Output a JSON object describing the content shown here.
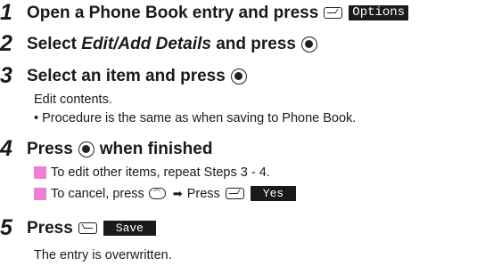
{
  "steps": [
    {
      "number": "1",
      "text": "Open a Phone Book entry and press",
      "key": "right-softkey-icon",
      "label": "Options"
    },
    {
      "number": "2",
      "prefix": "Select ",
      "italic": "Edit/Add Details",
      "suffix": " and press",
      "key": "center-key-icon"
    },
    {
      "number": "3",
      "text": "Select an item and press",
      "key": "center-key-icon",
      "body": [
        "Edit contents.",
        "• Procedure is the same as when saving to Phone Book."
      ]
    },
    {
      "number": "4",
      "prefix": "Press",
      "suffix": "when finished",
      "key": "center-key-icon",
      "notes": [
        {
          "text": "To edit other items, repeat Steps 3 - 4."
        },
        {
          "text": "To cancel, press",
          "mid": "Press",
          "label": "Yes"
        }
      ]
    },
    {
      "number": "5",
      "text": "Press",
      "key": "left-softkey-icon",
      "label": "Save",
      "body": [
        "The entry is overwritten."
      ]
    }
  ],
  "colors": {
    "note_marker": "#ef7fd0",
    "label_bg": "#1a1a1a"
  }
}
